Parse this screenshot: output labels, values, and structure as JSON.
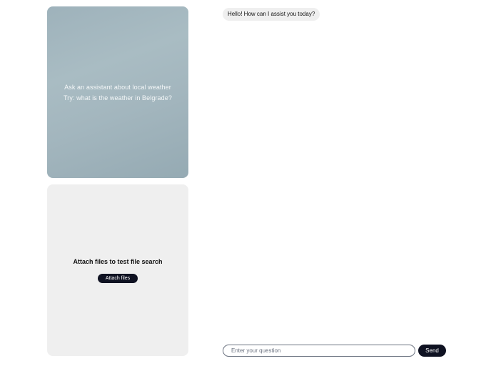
{
  "weather_card": {
    "line1": "Ask an assistant about local weather",
    "line2": "Try: what is the weather in Belgrade?"
  },
  "files_card": {
    "title": "Attach files to test file search",
    "attach_label": "Attach files"
  },
  "chat": {
    "messages": [
      {
        "role": "assistant",
        "text": "Hello! How can I assist you today?"
      }
    ]
  },
  "composer": {
    "placeholder": "Enter your question",
    "value": "",
    "send_label": "Send"
  },
  "colors": {
    "primary": "#0f1222",
    "bubble": "#efefef",
    "weather_card": "#a3b6be",
    "files_card": "#efefef"
  }
}
